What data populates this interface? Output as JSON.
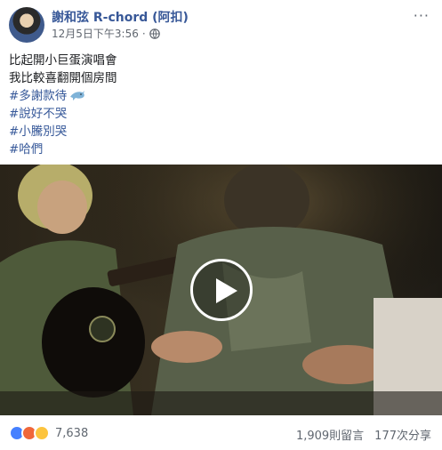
{
  "post": {
    "author": "謝和弦 R-chord (阿扣)",
    "timestamp": "12月5日下午3:56",
    "separator": "·",
    "privacy_icon": "globe-icon",
    "more_icon": "more-options-icon",
    "more_label": "···",
    "caption": [
      {
        "text": "比起開小巨蛋演唱會",
        "type": "text"
      },
      {
        "text": "我比較喜翻開個房間",
        "type": "text"
      },
      {
        "text": "#多謝款待",
        "type": "hashtag",
        "emoji": "dolphin"
      },
      {
        "text": "#說好不哭",
        "type": "hashtag"
      },
      {
        "text": "#小騰別哭",
        "type": "hashtag"
      },
      {
        "text": "#哈們",
        "type": "hashtag"
      }
    ]
  },
  "video": {
    "play_icon": "play-icon"
  },
  "footer": {
    "reactions": [
      "like",
      "angry",
      "haha"
    ],
    "reaction_count": "7,638",
    "comments": "1,909則留言",
    "shares": "177次分享"
  },
  "colors": {
    "link": "#365899",
    "author": "#385898",
    "muted": "#606770",
    "like": "#4580ff",
    "angry": "#f0673a",
    "haha": "#fcc43e"
  }
}
